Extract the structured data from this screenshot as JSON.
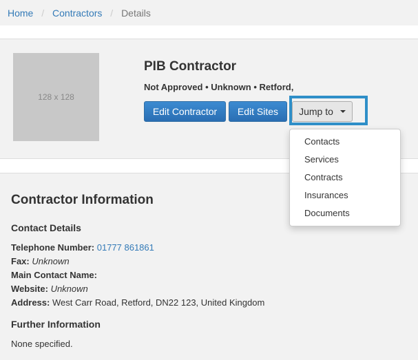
{
  "breadcrumb": {
    "items": [
      "Home",
      "Contractors"
    ],
    "separator": "/",
    "active": "Details"
  },
  "header": {
    "image_placeholder": "128 x 128",
    "title": "PIB Contractor",
    "subtitle": "Not Approved • Unknown • Retford,",
    "buttons": {
      "edit_contractor": "Edit Contractor",
      "edit_sites": "Edit Sites",
      "jump_to": "Jump to"
    }
  },
  "dropdown": {
    "items": [
      "Contacts",
      "Services",
      "Contracts",
      "Insurances",
      "Documents"
    ]
  },
  "info": {
    "heading": "Contractor Information",
    "contact_heading": "Contact Details",
    "telephone_label": "Telephone Number:",
    "telephone_value": "01777 861861",
    "fax_label": "Fax:",
    "fax_value": "Unknown",
    "main_contact_label": "Main Contact Name:",
    "website_label": "Website:",
    "website_value": "Unknown",
    "address_label": "Address:",
    "address_value": "West Carr Road, Retford, DN22 123, United Kingdom",
    "further_heading": "Further Information",
    "further_value": "None specified."
  },
  "colors": {
    "link": "#337ab7",
    "primary_button": "#337ab7",
    "highlight_border": "#2f8fc8"
  }
}
